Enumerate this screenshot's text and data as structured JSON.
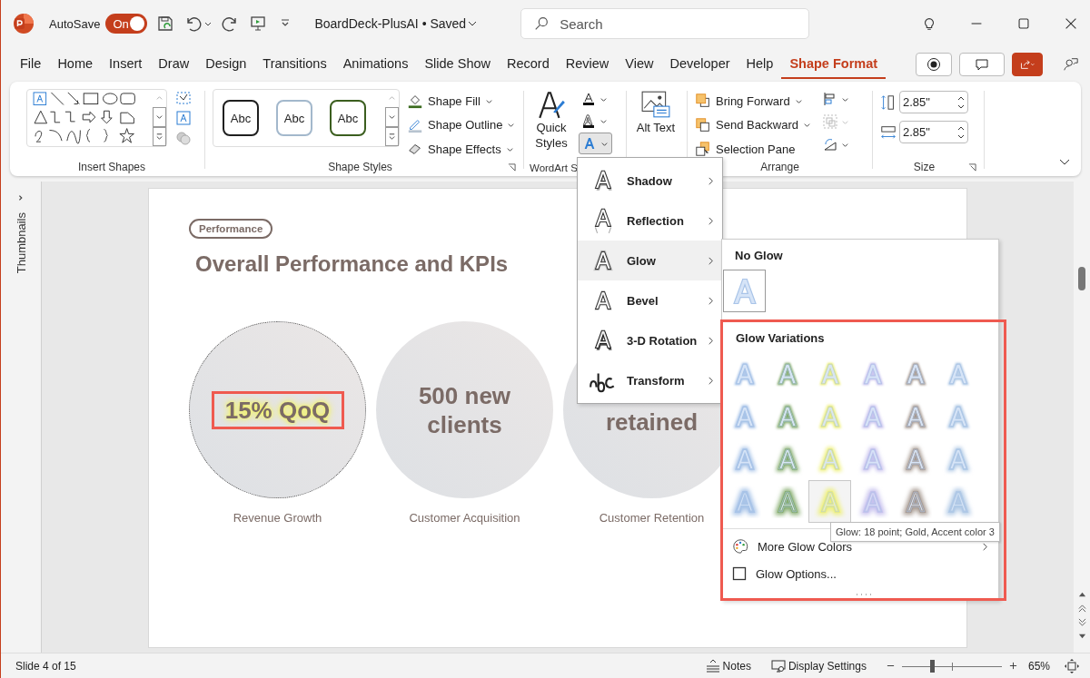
{
  "title_bar": {
    "autosave_label": "AutoSave",
    "autosave_toggle": {
      "label": "On",
      "on": true
    },
    "document_title": "BoardDeck-PlusAI • Saved",
    "search": {
      "placeholder": "Search"
    }
  },
  "tabs": [
    {
      "label": "File",
      "selected": false
    },
    {
      "label": "Home",
      "selected": false
    },
    {
      "label": "Insert",
      "selected": false
    },
    {
      "label": "Draw",
      "selected": false
    },
    {
      "label": "Design",
      "selected": false
    },
    {
      "label": "Transitions",
      "selected": false
    },
    {
      "label": "Animations",
      "selected": false
    },
    {
      "label": "Slide Show",
      "selected": false
    },
    {
      "label": "Record",
      "selected": false
    },
    {
      "label": "Review",
      "selected": false
    },
    {
      "label": "View",
      "selected": false
    },
    {
      "label": "Developer",
      "selected": false
    },
    {
      "label": "Help",
      "selected": false
    },
    {
      "label": "Shape Format",
      "selected": true
    }
  ],
  "ribbon": {
    "insert_shapes": {
      "label": "Insert Shapes"
    },
    "shape_styles": {
      "label": "Shape Styles",
      "presets": [
        {
          "label": "Abc",
          "color": "#1f1f1f"
        },
        {
          "label": "Abc",
          "color": "#a3b8cc"
        },
        {
          "label": "Abc",
          "color": "#3b5e1f"
        }
      ],
      "commands": [
        "Shape Fill",
        "Shape Outline",
        "Shape Effects"
      ]
    },
    "wordart_styles": {
      "label": "WordArt S",
      "quick_styles": "Quick Styles"
    },
    "alt_text": {
      "label": "Alt Text"
    },
    "arrange": {
      "label": "Arrange",
      "commands": [
        "Bring Forward",
        "Send Backward",
        "Selection Pane"
      ]
    },
    "size": {
      "label": "Size",
      "height": "2.85\"",
      "width": "2.85\""
    }
  },
  "thumbnails_label": "Thumbnails",
  "slide": {
    "tag": "Performance",
    "title": "Overall Performance and KPIs",
    "kpis": [
      {
        "value": "15% QoQ",
        "caption": "Revenue Growth",
        "selected": true,
        "glow": true,
        "highlighted": true
      },
      {
        "value": "500 new clients",
        "caption": "Customer Acquisition",
        "selected": false,
        "glow": false,
        "highlighted": false
      },
      {
        "value": "retained",
        "caption": "Customer Retention",
        "selected": false,
        "glow": false,
        "highlighted": false
      }
    ]
  },
  "text_effects_menu": {
    "items": [
      {
        "label": "Shadow",
        "kind": "shadow",
        "selected": false
      },
      {
        "label": "Reflection",
        "kind": "reflection",
        "selected": false
      },
      {
        "label": "Glow",
        "kind": "glow",
        "selected": true
      },
      {
        "label": "Bevel",
        "kind": "bevel",
        "selected": false
      },
      {
        "label": "3-D Rotation",
        "kind": "rotation",
        "selected": false
      },
      {
        "label": "Transform",
        "kind": "transform",
        "selected": false
      }
    ]
  },
  "glow_menu": {
    "no_glow_heading": "No Glow",
    "variations_heading": "Glow Variations",
    "highlighted": true,
    "variations": [
      [
        {
          "color": "#a9c4e8",
          "selected": false
        },
        {
          "color": "#86ad70",
          "selected": false
        },
        {
          "color": "#eef07a",
          "selected": false
        },
        {
          "color": "#c8c2ee",
          "selected": false
        },
        {
          "color": "#a89b93",
          "selected": false
        },
        {
          "color": "#b3cbe6",
          "selected": false
        }
      ],
      [
        {
          "color": "#a9c4e8",
          "selected": false
        },
        {
          "color": "#86ad70",
          "selected": false
        },
        {
          "color": "#eef07a",
          "selected": false
        },
        {
          "color": "#c8c2ee",
          "selected": false
        },
        {
          "color": "#a89b93",
          "selected": false
        },
        {
          "color": "#b3cbe6",
          "selected": false
        }
      ],
      [
        {
          "color": "#a9c4e8",
          "selected": false
        },
        {
          "color": "#86ad70",
          "selected": false
        },
        {
          "color": "#eef07a",
          "selected": false
        },
        {
          "color": "#c8c2ee",
          "selected": false
        },
        {
          "color": "#a89b93",
          "selected": false
        },
        {
          "color": "#b3cbe6",
          "selected": false
        }
      ],
      [
        {
          "color": "#a9c4e8",
          "selected": false
        },
        {
          "color": "#86ad70",
          "selected": false
        },
        {
          "color": "#eef07a",
          "selected": true
        },
        {
          "color": "#c8c2ee",
          "selected": false
        },
        {
          "color": "#a89b93",
          "selected": false
        },
        {
          "color": "#b3cbe6",
          "selected": false
        }
      ]
    ],
    "more_colors": "More Glow Colors",
    "options": "Glow Options...",
    "tooltip": "Glow: 18 point; Gold, Accent color 3"
  },
  "status_bar": {
    "slide_info": "Slide 4 of 15",
    "notes": "Notes",
    "display_settings": "Display Settings",
    "zoom": {
      "level": 0.3,
      "reading": "65%"
    }
  }
}
